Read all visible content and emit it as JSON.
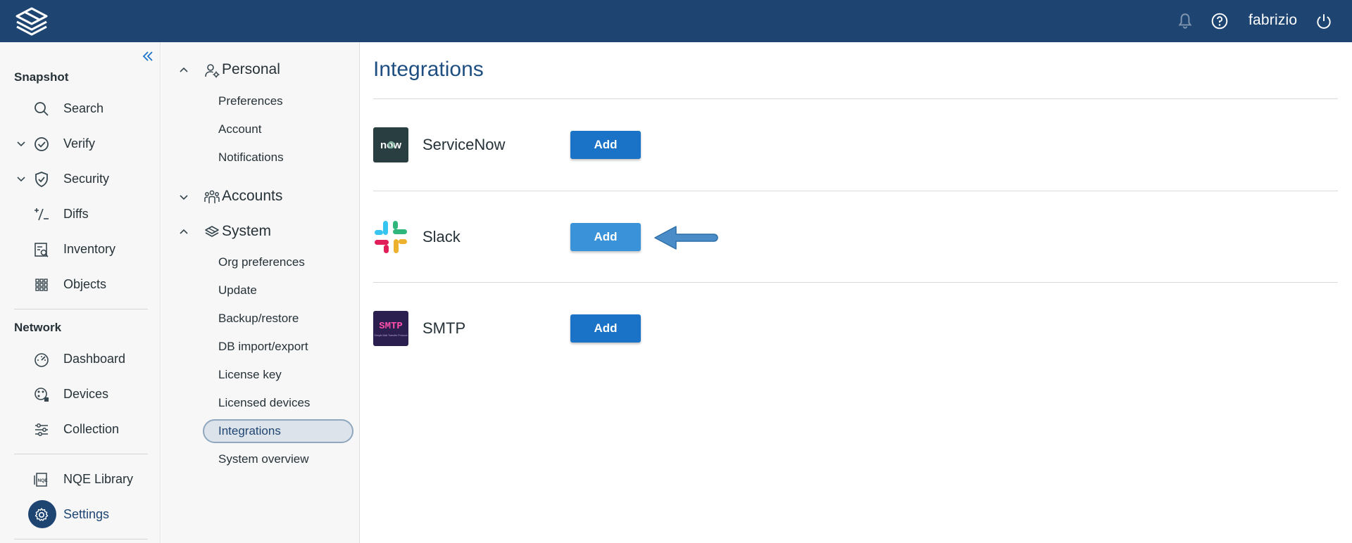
{
  "topbar": {
    "username": "fabrizio",
    "icons": [
      "app-logo-icon",
      "bell-icon",
      "help-icon",
      "power-icon"
    ]
  },
  "sidebar": {
    "sections": [
      {
        "title": "Snapshot",
        "items": [
          {
            "label": "Search",
            "icon": "search-icon"
          },
          {
            "label": "Verify",
            "icon": "check-circle-icon",
            "expandable": true
          },
          {
            "label": "Security",
            "icon": "shield-check-icon",
            "expandable": true
          },
          {
            "label": "Diffs",
            "icon": "diff-icon"
          },
          {
            "label": "Inventory",
            "icon": "inventory-icon"
          },
          {
            "label": "Objects",
            "icon": "grid-icon"
          }
        ]
      },
      {
        "title": "Network",
        "items": [
          {
            "label": "Dashboard",
            "icon": "gauge-icon"
          },
          {
            "label": "Devices",
            "icon": "devices-icon"
          },
          {
            "label": "Collection",
            "icon": "sliders-icon"
          }
        ]
      }
    ],
    "bottom_items": [
      {
        "label": "NQE Library",
        "icon": "nqe-icon"
      },
      {
        "label": "Settings",
        "icon": "gear-icon",
        "active": true
      }
    ]
  },
  "settings_nav": {
    "groups": [
      {
        "label": "Personal",
        "icon": "user-gear-icon",
        "expanded": true,
        "items": [
          "Preferences",
          "Account",
          "Notifications"
        ]
      },
      {
        "label": "Accounts",
        "icon": "users-icon",
        "expanded": false,
        "items": []
      },
      {
        "label": "System",
        "icon": "layers-icon",
        "expanded": true,
        "items": [
          "Org preferences",
          "Update",
          "Backup/restore",
          "DB import/export",
          "License key",
          "Licensed devices",
          "Integrations",
          "System overview"
        ]
      }
    ],
    "active_item": "Integrations"
  },
  "main": {
    "title": "Integrations",
    "integrations": [
      {
        "name": "ServiceNow",
        "logo_text": "now",
        "button_label": "Add"
      },
      {
        "name": "Slack",
        "button_label": "Add",
        "highlighted": true
      },
      {
        "name": "SMTP",
        "logo_text": "SMTP",
        "logo_subtext": "Simple Mail Transfer Protocol",
        "button_label": "Add"
      }
    ]
  },
  "colors": {
    "topbar": "#1e4571",
    "accent": "#1a73c6",
    "title": "#1e4f80",
    "arrow": "#4a8cc7"
  }
}
